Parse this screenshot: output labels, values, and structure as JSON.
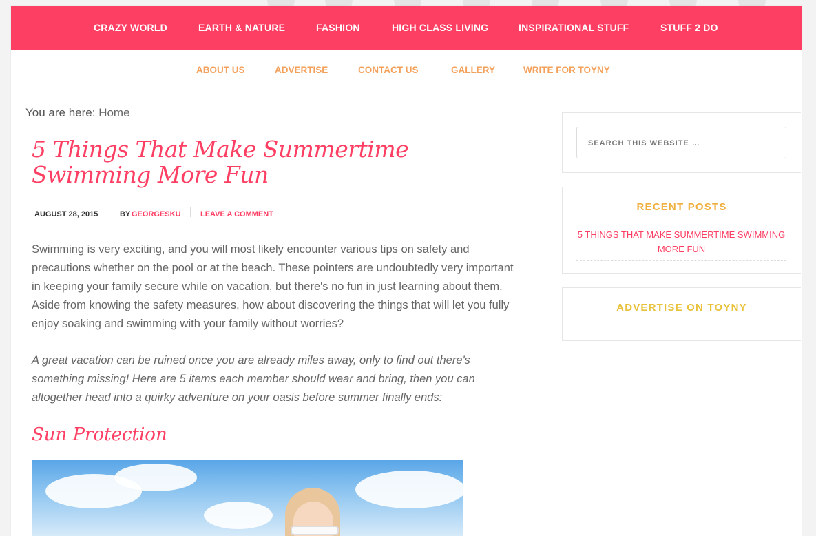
{
  "primary_nav": [
    "CRAZY WORLD",
    "EARTH & NATURE",
    "FASHION",
    "HIGH CLASS LIVING",
    "INSPIRATIONAL STUFF",
    "STUFF 2 DO"
  ],
  "secondary_nav": [
    "ABOUT US",
    "ADVERTISE",
    "CONTACT US",
    "GALLERY",
    "WRITE FOR TOYNY"
  ],
  "breadcrumb": {
    "prefix": "You are here:",
    "current": "Home"
  },
  "post": {
    "title": "5 Things That Make Summertime Swimming More Fun",
    "date": "AUGUST 28, 2015",
    "by_label": "BY",
    "author": "GEORGESKU",
    "comment_link": "LEAVE A COMMENT",
    "paragraph1": "Swimming is very exciting, and you will most likely encounter various tips on safety and precautions whether on the pool or at the beach. These pointers are undoubtedly very important in keeping your family secure while on vacation, but there's no fun in just learning about them. Aside from knowing the safety measures, how about discovering the things that will let you fully enjoy soaking and swimming with your family without worries?",
    "paragraph2": "A great vacation can be ruined once you are already miles away, only to find out there's something missing! Here are 5 items each member should wear and bring, then you can altogether head into a quirky adventure on your oasis before summer finally ends:",
    "subheading": "Sun Protection"
  },
  "sidebar": {
    "search_placeholder": "SEARCH THIS WEBSITE …",
    "recent_posts_title": "RECENT POSTS",
    "recent_posts": [
      "5 THINGS THAT MAKE SUMMERTIME SWIMMING MORE FUN"
    ],
    "advertise_title": "ADVERTISE ON TOYNY"
  },
  "colors": {
    "brand_pink": "#fd3f63",
    "nav_orange": "#f3a05a",
    "widget_gold": "#e8c23a"
  }
}
